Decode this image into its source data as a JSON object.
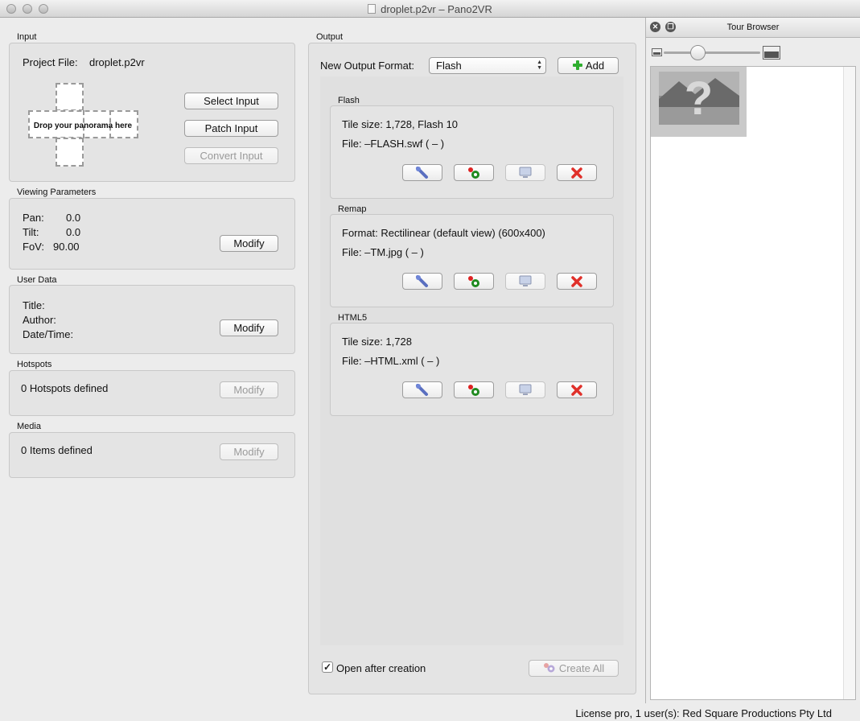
{
  "window": {
    "title": "droplet.p2vr  – Pano2VR"
  },
  "input": {
    "section_label": "Input",
    "project_file_label": "Project File:",
    "project_file_value": "droplet.p2vr",
    "drop_text": "Drop your panorama here",
    "select_input_label": "Select Input",
    "patch_input_label": "Patch Input",
    "convert_input_label": "Convert Input"
  },
  "viewing": {
    "section_label": "Viewing Parameters",
    "pan_label": "Pan:",
    "pan_value": "0.0",
    "tilt_label": "Tilt:",
    "tilt_value": "0.0",
    "fov_label": "FoV:",
    "fov_value": "90.00",
    "modify_label": "Modify"
  },
  "user_data": {
    "section_label": "User Data",
    "title_label": "Title:",
    "author_label": "Author:",
    "datetime_label": "Date/Time:",
    "modify_label": "Modify"
  },
  "hotspots": {
    "section_label": "Hotspots",
    "summary": "0 Hotspots defined",
    "modify_label": "Modify"
  },
  "media": {
    "section_label": "Media",
    "summary": "0 Items defined",
    "modify_label": "Modify"
  },
  "output": {
    "section_label": "Output",
    "new_format_label": "New Output Format:",
    "format_selected": "Flash",
    "add_label": "Add",
    "formats": [
      {
        "name": "Flash",
        "line1": "Tile size: 1,728, Flash 10",
        "line2": "File: –FLASH.swf ( – )"
      },
      {
        "name": "Remap",
        "line1": "Format: Rectilinear (default view) (600x400)",
        "line2": "File: –TM.jpg ( – )"
      },
      {
        "name": "HTML5",
        "line1": "Tile size: 1,728",
        "line2": "File: –HTML.xml ( – )"
      }
    ],
    "open_after_label": "Open after creation",
    "open_after_checked": true,
    "create_all_label": "Create All"
  },
  "tour_browser": {
    "title": "Tour Browser",
    "thumbnail_symbol": "?",
    "zoom_level": 0.35
  },
  "status": {
    "license_text": "License pro, 1 user(s): Red Square Productions Pty Ltd"
  },
  "icons": {
    "settings": "wrench-icon",
    "generate": "gears-icon",
    "preview": "monitor-icon",
    "delete": "delete-icon"
  }
}
